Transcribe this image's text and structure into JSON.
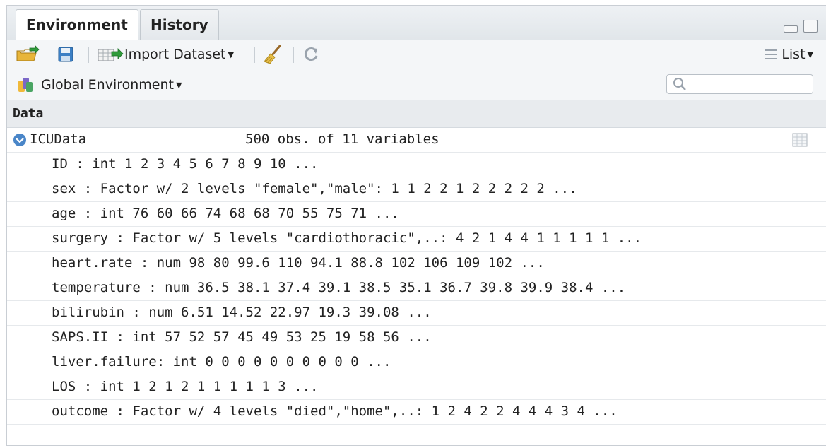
{
  "tabs": [
    "Environment",
    "History"
  ],
  "toolbar": {
    "import_label": "Import Dataset",
    "list_label": "List"
  },
  "env": {
    "scope_label": "Global Environment",
    "search_placeholder": ""
  },
  "section_title": "Data",
  "dataset": {
    "name": "ICUData",
    "summary": "500 obs. of 11 variables"
  },
  "variables": [
    "ID : int 1 2 3 4 5 6 7 8 9 10 ...",
    "sex : Factor w/ 2 levels \"female\",\"male\": 1 1 2 2 1 2 2 2 2 2 ...",
    "age : int 76 60 66 74 68 68 70 55 75 71 ...",
    "surgery : Factor w/ 5 levels \"cardiothoracic\",..: 4 2 1 4 4 1 1 1 1 1 ...",
    "heart.rate : num 98 80 99.6 110 94.1 88.8 102 106 109 102 ...",
    "temperature : num 36.5 38.1 37.4 39.1 38.5 35.1 36.7 39.8 39.9 38.4 ...",
    "bilirubin : num 6.51 14.52 22.97 19.3 39.08 ...",
    "SAPS.II : int 57 52 57 45 49 53 25 19 58 56 ...",
    "liver.failure: int 0 0 0 0 0 0 0 0 0 0 ...",
    "LOS : int 1 2 1 2 1 1 1 1 1 3 ...",
    "outcome : Factor w/ 4 levels \"died\",\"home\",..: 1 2 4 2 2 4 4 4 3 4 ..."
  ],
  "colors": {
    "accent_blue": "#4a86c8",
    "header_bg": "#e8ebee"
  }
}
